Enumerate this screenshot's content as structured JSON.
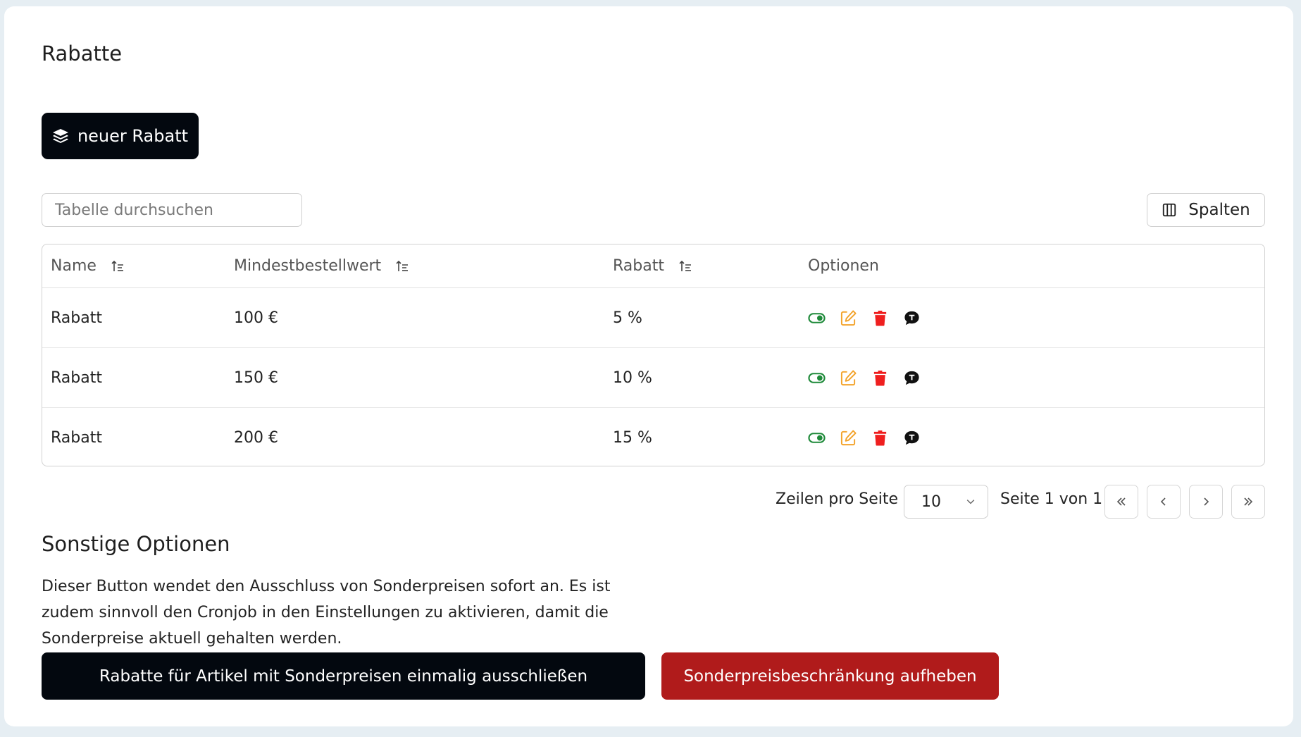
{
  "page": {
    "title": "Rabatte"
  },
  "toolbar": {
    "new_label": "neuer Rabatt",
    "search_placeholder": "Tabelle durchsuchen",
    "columns_label": "Spalten"
  },
  "table": {
    "headers": {
      "name": "Name",
      "min_order": "Mindestbestellwert",
      "discount": "Rabatt",
      "options": "Optionen"
    },
    "rows": [
      {
        "name": "Rabatt",
        "min_order": "100 €",
        "discount": "5 %"
      },
      {
        "name": "Rabatt",
        "min_order": "150 €",
        "discount": "10 %"
      },
      {
        "name": "Rabatt",
        "min_order": "200 €",
        "discount": "15 %"
      }
    ]
  },
  "pagination": {
    "rows_per_page_label": "Zeilen pro Seite",
    "rows_per_page_value": "10",
    "page_info": "Seite 1 von 1"
  },
  "other_options": {
    "title": "Sonstige Optionen",
    "description": "Dieser Button wendet den Ausschluss von Sonderpreisen sofort an. Es ist zudem sinnvoll den Cronjob in den Einstellungen zu aktivieren, damit die Sonderpreise aktuell gehalten werden.",
    "exclude_button": "Rabatte für Artikel mit Sonderpreisen einmalig ausschließen",
    "remove_button": "Sonderpreisbeschränkung aufheben"
  },
  "colors": {
    "primary_dark": "#03080f",
    "danger": "#b01b1b",
    "toggle_green": "#1f8a3a",
    "edit_orange": "#f3a32b",
    "delete_red": "#ef1f1f"
  },
  "icons": [
    "layers-icon",
    "columns-icon",
    "sort-icon",
    "toggle-visibility-icon",
    "edit-icon",
    "delete-icon",
    "comment-icon",
    "chevron-down-icon",
    "first-page-icon",
    "prev-page-icon",
    "next-page-icon",
    "last-page-icon"
  ]
}
